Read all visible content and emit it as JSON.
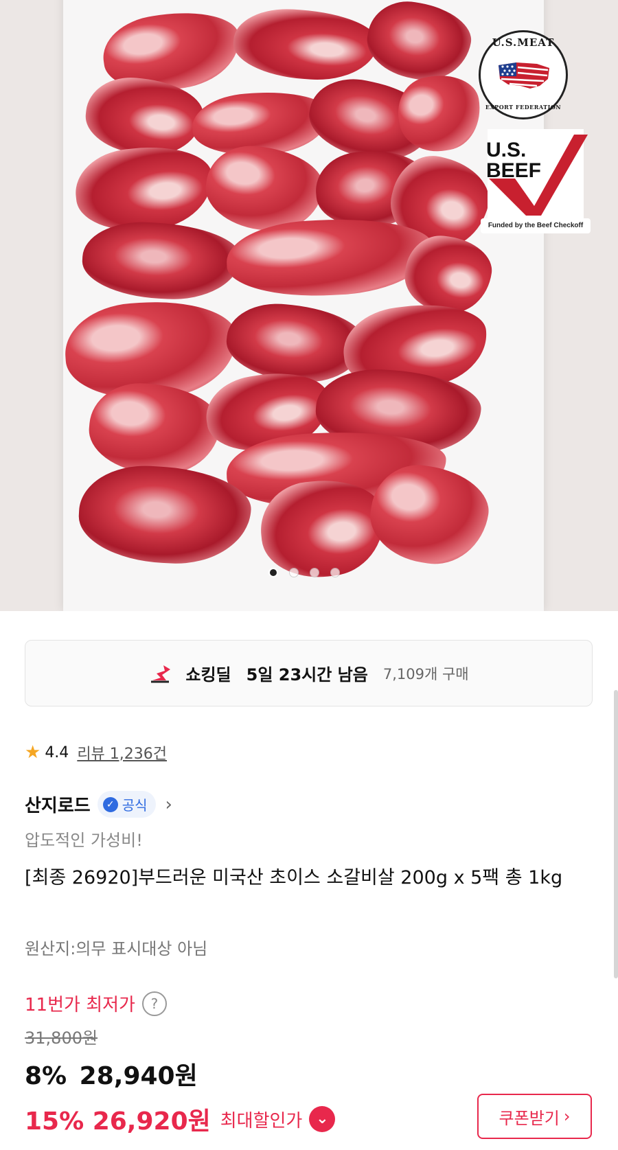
{
  "hero": {
    "badges": {
      "usmef_top": "U.S.MEAT",
      "usmef_bottom": "EXPORT FEDERATION",
      "usbeef_word": "U.S. BEEF",
      "usbeef_caption": "Funded by the Beef Checkoff"
    },
    "carousel": {
      "count": 4,
      "active": 1
    }
  },
  "deal": {
    "icon": "shocking-deal-icon",
    "name": "쇼킹딜",
    "time_left": "5일 23시간 남음",
    "sold": "7,109개 구매"
  },
  "rating": {
    "score": "4.4",
    "reviews": "리뷰 1,236건"
  },
  "seller": {
    "name": "산지로드",
    "official_label": "공식",
    "chevron": "›"
  },
  "product": {
    "tagline": "압도적인 가성비!",
    "title": "[최종 26920]부드러운 미국산 초이스 소갈비살 200g x 5팩 총 1kg",
    "origin": "원산지:의무 표시대상 아님"
  },
  "price": {
    "lowest_label": "11번가 최저가",
    "help": "?",
    "original": "31,800원",
    "sale_pct": "8%",
    "sale_price": "28,940원",
    "best_pct_price": "15% 26,920원",
    "best_label": "최대할인가",
    "coupon_label": "쿠폰받기",
    "coupon_chevron": "›"
  },
  "colors": {
    "accent": "#e8284c",
    "official": "#2f6be0",
    "star": "#f5a623"
  }
}
